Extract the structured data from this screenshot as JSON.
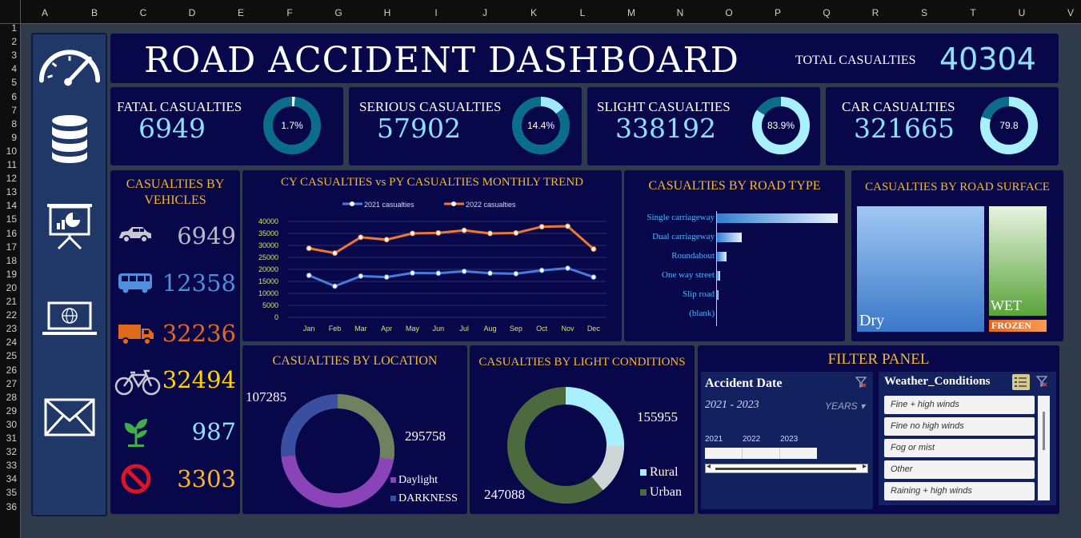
{
  "grid": {
    "columns": [
      "A",
      "B",
      "C",
      "D",
      "E",
      "F",
      "G",
      "H",
      "I",
      "J",
      "K",
      "L",
      "M",
      "N",
      "O",
      "P",
      "Q",
      "R",
      "S",
      "T",
      "U",
      "V"
    ],
    "rows": [
      "1",
      "2",
      "3",
      "4",
      "5",
      "6",
      "7",
      "8",
      "9",
      "10",
      "11",
      "12",
      "13",
      "14",
      "15",
      "16",
      "17",
      "18",
      "19",
      "20",
      "21",
      "22",
      "23",
      "24",
      "25",
      "26",
      "27",
      "28",
      "29",
      "30",
      "31",
      "32",
      "33",
      "34",
      "35",
      "36"
    ]
  },
  "sidebar": {
    "icons": [
      "speedometer-icon",
      "database-icon",
      "presentation-icon",
      "laptop-globe-icon",
      "envelope-icon"
    ]
  },
  "header": {
    "title": "ROAD ACCIDENT DASHBOARD",
    "total_label": "TOTAL CASUALTIES",
    "total_value": "40304"
  },
  "kpis": [
    {
      "label": "FATAL CASUALTIES",
      "value": "6949",
      "pct_label": "1.7%",
      "fraction": 0.017
    },
    {
      "label": "SERIOUS CASUALTIES",
      "value": "57902",
      "pct_label": "14.4%",
      "fraction": 0.144
    },
    {
      "label": "SLIGHT CASUALTIES",
      "value": "338192",
      "pct_label": "83.9%",
      "fraction": 0.839
    },
    {
      "label": "CAR CASUALTIES",
      "value": "321665",
      "pct_label": "79.8",
      "fraction": 0.798
    }
  ],
  "vehicles": {
    "title_line1": "CASUALTIES BY",
    "title_line2": "VEHICLES",
    "items": [
      {
        "icon": "car-icon",
        "value": "6949",
        "color": "#b8b8c8"
      },
      {
        "icon": "bus-icon",
        "value": "12358",
        "color": "#4f8fdc"
      },
      {
        "icon": "truck-icon",
        "value": "32236",
        "color": "#e06a1c"
      },
      {
        "icon": "bicycle-icon",
        "value": "32494",
        "color": "#ffd400"
      },
      {
        "icon": "plant-icon",
        "value": "987",
        "color": "#8fe0ff"
      },
      {
        "icon": "no-entry-icon",
        "value": "3303",
        "color": "#f4b833"
      }
    ]
  },
  "trend": {
    "title": "CY CASUALTIES  vs   PY CASUALTIES MONTHLY TREND",
    "legend_2021": "2021 casualties",
    "legend_2022": "2022 casualties",
    "y_ticks": [
      "40000",
      "35000",
      "30000",
      "25000",
      "20000",
      "15000",
      "10000",
      "5000",
      "0"
    ]
  },
  "road_type": {
    "title": "CASUALTIES BY ROAD TYPE",
    "labels": [
      "Single carriageway",
      "Dual carriageway",
      "Roundabout",
      "One way street",
      "Slip road",
      "(blank)"
    ]
  },
  "surface": {
    "title": "CASUALTIES BY ROAD SURFACE",
    "dry": "Dry",
    "wet": "WET",
    "frozen": "FROZEN"
  },
  "location": {
    "title": "CASUALTIES BY LOCATION",
    "value_a": "107285",
    "value_b": "295758",
    "legend": [
      "Daylight",
      "DARKNESS"
    ]
  },
  "light": {
    "title": "CASUALTIES BY LIGHT CONDITIONS",
    "value_a": "155955",
    "value_b": "247088",
    "legend": [
      "Rural",
      "Urban"
    ]
  },
  "filter": {
    "title": "FILTER PANEL",
    "date_title": "Accident  Date",
    "date_range": "2021 - 2023",
    "date_unit": "YEARS",
    "years": [
      "2021",
      "2022",
      "2023"
    ],
    "weather_title": "Weather_Conditions",
    "weather_items": [
      "Fine + high winds",
      "Fine no high winds",
      "Fog or mist",
      "Other",
      "Raining + high winds"
    ]
  },
  "chart_data": [
    {
      "type": "line",
      "title": "CY CASUALTIES  vs   PY CASUALTIES MONTHLY TREND",
      "categories": [
        "Jan",
        "Feb",
        "Mar",
        "Apr",
        "May",
        "Jun",
        "Jul",
        "Aug",
        "Sep",
        "Oct",
        "Nov",
        "Dec"
      ],
      "ylim": [
        0,
        40000
      ],
      "series": [
        {
          "name": "2021 casualties",
          "color": "#4a7bdc",
          "values": [
            17500,
            13000,
            17200,
            16800,
            18500,
            18400,
            19200,
            18400,
            18200,
            19600,
            20500,
            16800
          ]
        },
        {
          "name": "2022 casualties",
          "color": "#ec7a2c",
          "values": [
            28800,
            26800,
            33400,
            32400,
            35000,
            35200,
            36300,
            35000,
            35200,
            37800,
            38000,
            28500
          ]
        }
      ]
    },
    {
      "type": "bar",
      "title": "CASUALTIES BY ROAD TYPE",
      "categories": [
        "Single carriageway",
        "Dual carriageway",
        "Roundabout",
        "One way street",
        "Slip road",
        "(blank)"
      ],
      "values": [
        300000,
        62000,
        24000,
        8000,
        4500,
        0
      ]
    },
    {
      "type": "heatmap",
      "title": "CASUALTIES BY ROAD SURFACE",
      "categories": [
        "Dry",
        "WET",
        "FROZEN"
      ],
      "values": [
        280000,
        110000,
        12000
      ]
    },
    {
      "type": "pie",
      "title": "CASUALTIES BY LOCATION",
      "categories": [
        "Daylight",
        "DARKNESS"
      ],
      "values": [
        295758,
        107285
      ],
      "colors": [
        "#8a44b8",
        "#3a4fa0"
      ]
    },
    {
      "type": "pie",
      "title": "CASUALTIES BY LIGHT CONDITIONS",
      "categories": [
        "Rural",
        "Urban"
      ],
      "values": [
        155955,
        247088
      ],
      "colors": [
        "#a9f0ff",
        "#4c6a3e"
      ]
    }
  ]
}
